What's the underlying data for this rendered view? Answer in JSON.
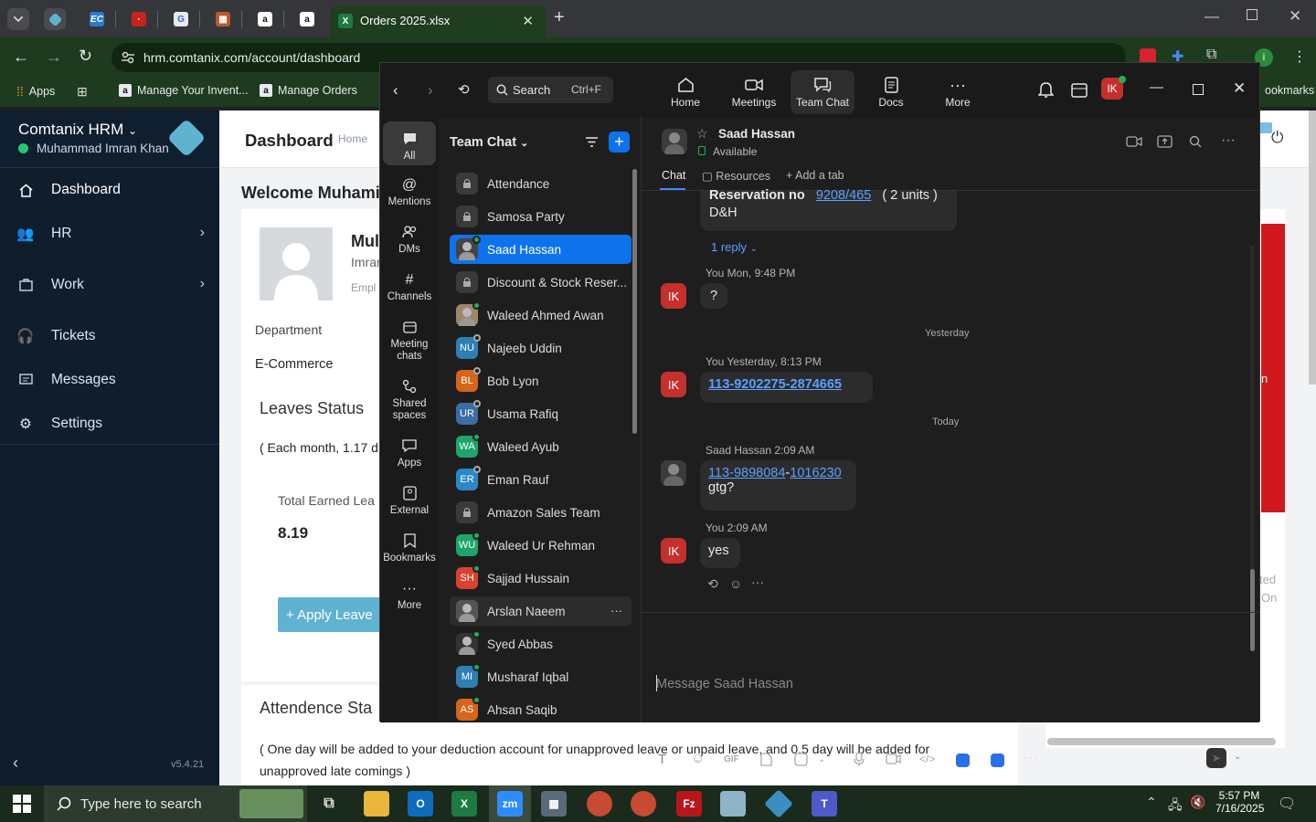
{
  "browser": {
    "active_tab": "Orders 2025.xlsx",
    "url": "hrm.comtanix.com/account/dashboard",
    "bookmarks": [
      "Apps",
      "Manage Your Invent...",
      "Manage Orders"
    ],
    "bookmarks_right": "ookmarks"
  },
  "hrm": {
    "brand": "Comtanix HRM",
    "user": "Muhammad Imran Khan",
    "nav": [
      "Dashboard",
      "HR",
      "Work",
      "Tickets",
      "Messages",
      "Settings"
    ],
    "version": "v5.4.21",
    "page_title": "Dashboard",
    "crumb": "Home",
    "welcome": "Welcome Muhami",
    "profile_name": "Mul",
    "profile_sub": "Imran",
    "profile_role": "Empl",
    "department_label": "Department",
    "department_value": "E-Commerce",
    "leaves_title": "Leaves Status",
    "leaves_note": "( Each month, 1.17 d",
    "earned_label": "Total Earned Lea",
    "earned_value": "8.19",
    "apply_button": "+ Apply Leave",
    "attendance_title": "Attendence Sta",
    "attendance_note": "( One day will be added to your deduction account for unapproved leave or unpaid leave, and 0.5 day will be added for unapproved late comings )",
    "right_frag1": "n",
    "right_frag2": "ted",
    "right_frag3": "On"
  },
  "zoom": {
    "search_label": "Search",
    "search_shortcut": "Ctrl+F",
    "tabs": [
      "Home",
      "Meetings",
      "Team Chat",
      "Docs",
      "More"
    ],
    "user_initials": "IK",
    "rail": [
      "All",
      "Mentions",
      "DMs",
      "Channels",
      "Meeting chats",
      "Shared spaces",
      "Apps",
      "External",
      "Bookmarks",
      "More"
    ],
    "list_title": "Team Chat",
    "list": [
      {
        "name": "Attendance",
        "type": "lock",
        "init": ""
      },
      {
        "name": "Samosa Party",
        "type": "lock",
        "init": ""
      },
      {
        "name": "Saad Hassan",
        "type": "photo",
        "init": "",
        "color": "#444"
      },
      {
        "name": "Discount & Stock Reser...",
        "type": "lock",
        "init": ""
      },
      {
        "name": "Waleed Ahmed Awan",
        "type": "photo",
        "init": "",
        "color": "#a0856a"
      },
      {
        "name": "Najeeb Uddin",
        "type": "init",
        "init": "NU",
        "color": "#2f7fb5"
      },
      {
        "name": "Bob Lyon",
        "type": "init",
        "init": "BL",
        "color": "#d4651b"
      },
      {
        "name": "Usama Rafiq",
        "type": "init",
        "init": "UR",
        "color": "#3b6ea5"
      },
      {
        "name": "Waleed Ayub",
        "type": "init",
        "init": "WA",
        "color": "#1fa56b"
      },
      {
        "name": "Eman Rauf",
        "type": "init",
        "init": "ER",
        "color": "#2b88c8"
      },
      {
        "name": "Amazon Sales Team",
        "type": "lock",
        "init": ""
      },
      {
        "name": "Waleed Ur Rehman",
        "type": "init",
        "init": "WU",
        "color": "#1fa56b"
      },
      {
        "name": "Sajjad Hussain",
        "type": "init",
        "init": "SH",
        "color": "#d8432f"
      },
      {
        "name": "Arslan Naeem",
        "type": "photo",
        "init": "",
        "color": "#555"
      },
      {
        "name": "Syed Abbas",
        "type": "photo",
        "init": "",
        "color": "#333"
      },
      {
        "name": "Musharaf Iqbal",
        "type": "init",
        "init": "MI",
        "color": "#2f7fb5"
      },
      {
        "name": "Ahsan Saqib",
        "type": "init",
        "init": "AS",
        "color": "#d4651b"
      }
    ],
    "contact_name": "Saad Hassan",
    "contact_status": "Available",
    "chat_tabs": [
      "Chat",
      "Resources",
      "Add a tab"
    ],
    "msg_top_prefix": "Reservation no",
    "msg_top_link": "9208/465",
    "msg_top_suffix": "( 2 units )",
    "msg_top_line2": "D&H",
    "reply_label": "1 reply",
    "m1_meta": "You Mon, 9:48 PM",
    "m1_text": "?",
    "div_yesterday": "Yesterday",
    "m2_meta": "You Yesterday, 8:13 PM",
    "m2_link": "113-9202275-2874665",
    "div_today": "Today",
    "m3_meta": "Saad Hassan 2:09 AM",
    "m3_link_a": "113-9898084",
    "m3_dash": "-",
    "m3_link_b": "1016230",
    "m3_text": "gtg?",
    "m4_meta": "You 2:09 AM",
    "m4_text": "yes",
    "composer_placeholder": "Message Saad Hassan",
    "gif_label": "GIF"
  },
  "taskbar": {
    "search": "Type here to search",
    "time": "5:57 PM",
    "date": "7/16/2025"
  }
}
